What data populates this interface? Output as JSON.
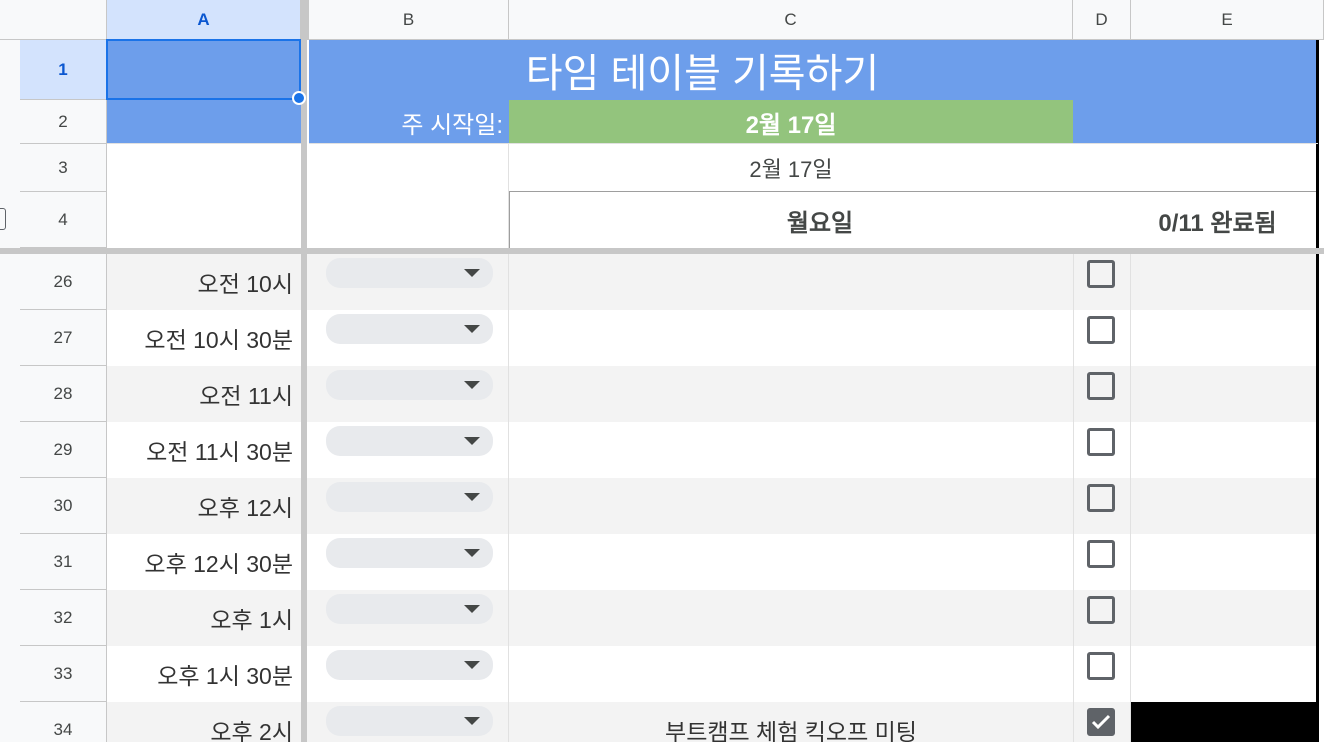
{
  "columns": [
    "A",
    "B",
    "C",
    "D",
    "E"
  ],
  "frozen_rows": [
    {
      "num": "1"
    },
    {
      "num": "2"
    },
    {
      "num": "3"
    },
    {
      "num": "4"
    }
  ],
  "header": {
    "title": "타임 테이블 기록하기",
    "week_start_label": "주 시작일:",
    "week_start_date": "2월 17일",
    "date_sub": "2월 17일",
    "day_name": "월요일",
    "done_count": "0/11 완료됨"
  },
  "rows": [
    {
      "num": "26",
      "time": "오전 10시",
      "task": "",
      "checked": false
    },
    {
      "num": "27",
      "time": "오전 10시 30분",
      "task": "",
      "checked": false
    },
    {
      "num": "28",
      "time": "오전 11시",
      "task": "",
      "checked": false
    },
    {
      "num": "29",
      "time": "오전 11시 30분",
      "task": "",
      "checked": false
    },
    {
      "num": "30",
      "time": "오후 12시",
      "task": "",
      "checked": false
    },
    {
      "num": "31",
      "time": "오후 12시 30분",
      "task": "",
      "checked": false
    },
    {
      "num": "32",
      "time": "오후 1시",
      "task": "",
      "checked": false
    },
    {
      "num": "33",
      "time": "오후 1시 30분",
      "task": "",
      "checked": false
    },
    {
      "num": "34",
      "time": "오후 2시",
      "task": "부트캠프 체험 킥오프 미팅",
      "checked": true
    }
  ],
  "colors": {
    "header_blue": "#6d9eeb",
    "date_green": "#93c47d",
    "selection": "#1a73e8",
    "row_alt": "#f3f3f3"
  }
}
